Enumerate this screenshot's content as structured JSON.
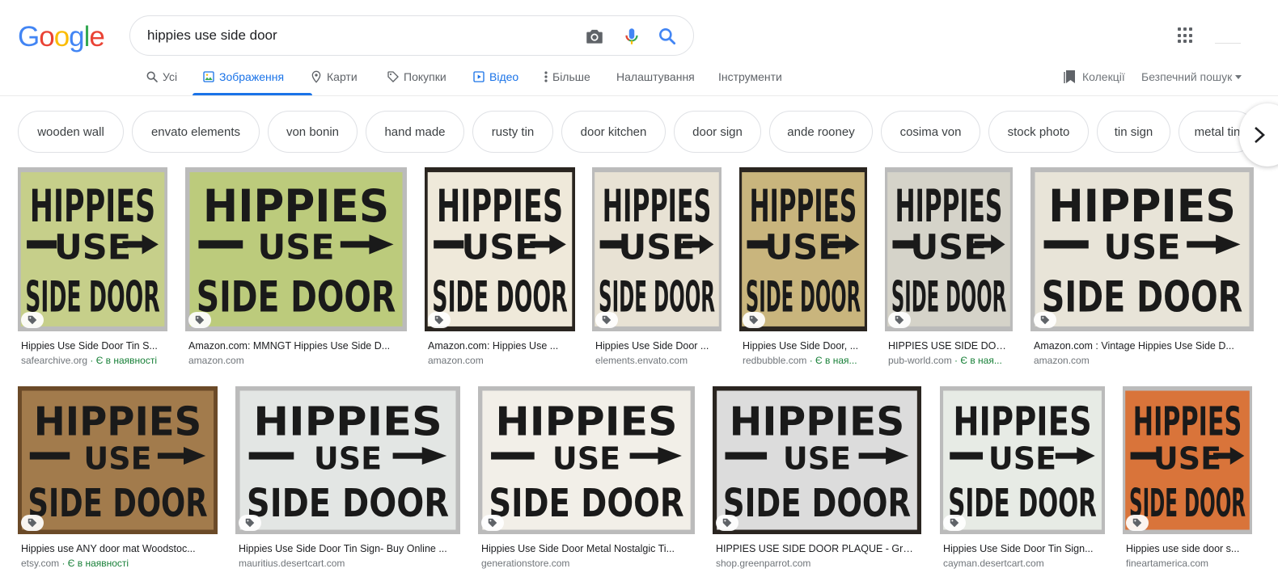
{
  "logo": {
    "letters": [
      "G",
      "o",
      "o",
      "g",
      "l",
      "e"
    ],
    "colors": [
      "#4285F4",
      "#EA4335",
      "#FBBC05",
      "#4285F4",
      "#34A853",
      "#EA4335"
    ]
  },
  "search": {
    "query": "hippies use side door"
  },
  "tabs": {
    "all": "Усі",
    "images": "Зображення",
    "maps": "Карти",
    "shopping": "Покупки",
    "videos": "Відео",
    "more": "Більше",
    "settings": "Налаштування",
    "tools": "Інструменти"
  },
  "right": {
    "collections": "Колекції",
    "safesearch": "Безпечний пошук"
  },
  "chips": [
    "wooden wall",
    "envato elements",
    "von bonin",
    "hand made",
    "rusty tin",
    "door kitchen",
    "door sign",
    "ande rooney",
    "cosima von",
    "stock photo",
    "tin sign",
    "metal tin"
  ],
  "sign_text": {
    "line1": "HIPPIES",
    "line2": "USE",
    "line3": "SIDE DOOR"
  },
  "results": [
    {
      "title": "Hippies Use Side Door Tin S...",
      "source": "safearchive.org",
      "stock": "· Є в наявності",
      "bg": "#c6cf8a"
    },
    {
      "title": "Amazon.com: MMNGT Hippies Use Side D...",
      "source": "amazon.com",
      "stock": "",
      "bg": "#bccb7c"
    },
    {
      "title": "Amazon.com: Hippies Use ...",
      "source": "amazon.com",
      "stock": "",
      "bg": "#efe9da"
    },
    {
      "title": "Hippies Use Side Door ...",
      "source": "elements.envato.com",
      "stock": "",
      "bg": "#e8e2d4"
    },
    {
      "title": "Hippies Use Side Door, ...",
      "source": "redbubble.com",
      "stock": "· Є в ная...",
      "bg": "#c9b57d"
    },
    {
      "title": "HIPPIES USE SIDE DOO...",
      "source": "pub-world.com",
      "stock": "· Є в ная...",
      "bg": "#d5d3c9"
    },
    {
      "title": "Amazon.com : Vintage Hippies Use Side D...",
      "source": "amazon.com",
      "stock": "",
      "bg": "#e8e4d8"
    },
    {
      "title": "Hippies use ANY door mat Woodstoc...",
      "source": "etsy.com",
      "stock": "· Є в наявності",
      "bg": "#a27b4c"
    },
    {
      "title": "Hippies Use Side Door Tin Sign- Buy Online ...",
      "source": "mauritius.desertcart.com",
      "stock": "",
      "bg": "#e3e6e4"
    },
    {
      "title": "Hippies Use Side Door Metal Nostalgic Ti...",
      "source": "generationstore.com",
      "stock": "",
      "bg": "#f2efe8"
    },
    {
      "title": "HIPPIES USE SIDE DOOR PLAQUE - Gree...",
      "source": "shop.greenparrot.com",
      "stock": "",
      "bg": "#dcdcdc"
    },
    {
      "title": "Hippies Use Side Door Tin Sign...",
      "source": "cayman.desertcart.com",
      "stock": "",
      "bg": "#e7ebe5"
    },
    {
      "title": "Hippies use side door s...",
      "source": "fineartamerica.com",
      "stock": "",
      "bg": "#d9743a"
    }
  ],
  "colors": {
    "accent": "#1a73e8",
    "stock_green": "#188038"
  }
}
